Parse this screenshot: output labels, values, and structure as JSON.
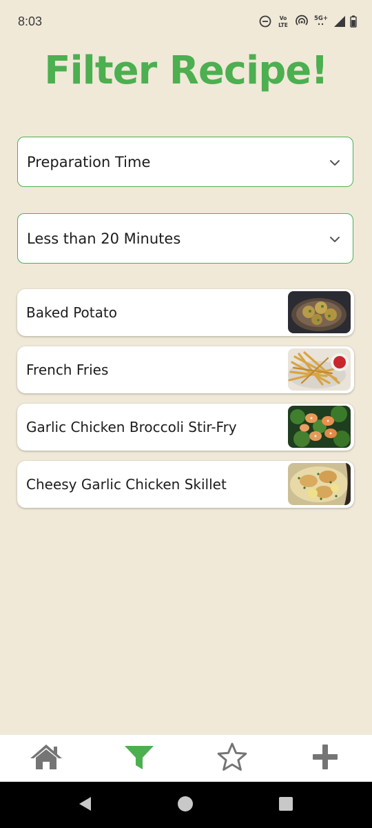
{
  "status_bar": {
    "time": "8:03",
    "network_label": "5G+",
    "volte_label": "Vo LTE"
  },
  "header": {
    "title": "Filter Recipe!"
  },
  "filters": {
    "category": {
      "selected": "Preparation Time"
    },
    "value": {
      "selected": "Less than 20 Minutes"
    }
  },
  "recipes": [
    {
      "name": "Baked Potato"
    },
    {
      "name": "French Fries"
    },
    {
      "name": "Garlic Chicken Broccoli Stir-Fry"
    },
    {
      "name": "Cheesy Garlic Chicken Skillet"
    }
  ],
  "bottom_nav": {
    "items": [
      {
        "icon": "home-icon",
        "active": false
      },
      {
        "icon": "filter-icon",
        "active": true
      },
      {
        "icon": "star-icon",
        "active": false
      },
      {
        "icon": "plus-icon",
        "active": false
      }
    ]
  },
  "colors": {
    "accent": "#4CAF50",
    "background": "#F0E9D8",
    "nav_inactive": "#757575"
  }
}
